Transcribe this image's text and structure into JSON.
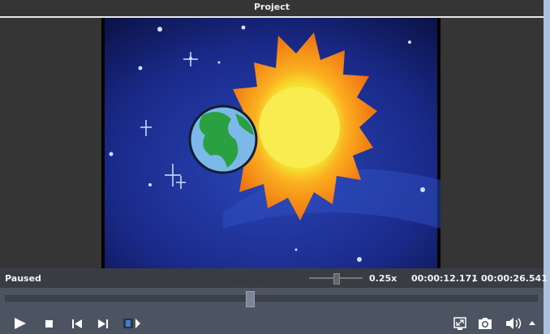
{
  "window": {
    "title": "Project"
  },
  "status": {
    "state": "Paused",
    "speed": "0.25x",
    "current_time": "00:00:12.171",
    "separator": "/",
    "total_time": "00:00:26.541"
  },
  "playback": {
    "progress_fraction": 0.459,
    "speed_slider_fraction": 0.5
  },
  "icons": [
    "play-icon",
    "stop-icon",
    "previous-frame-icon",
    "next-frame-icon",
    "clip-play-icon",
    "fullscreen-icon",
    "snapshot-icon",
    "volume-icon",
    "volume-menu-arrow-icon"
  ]
}
